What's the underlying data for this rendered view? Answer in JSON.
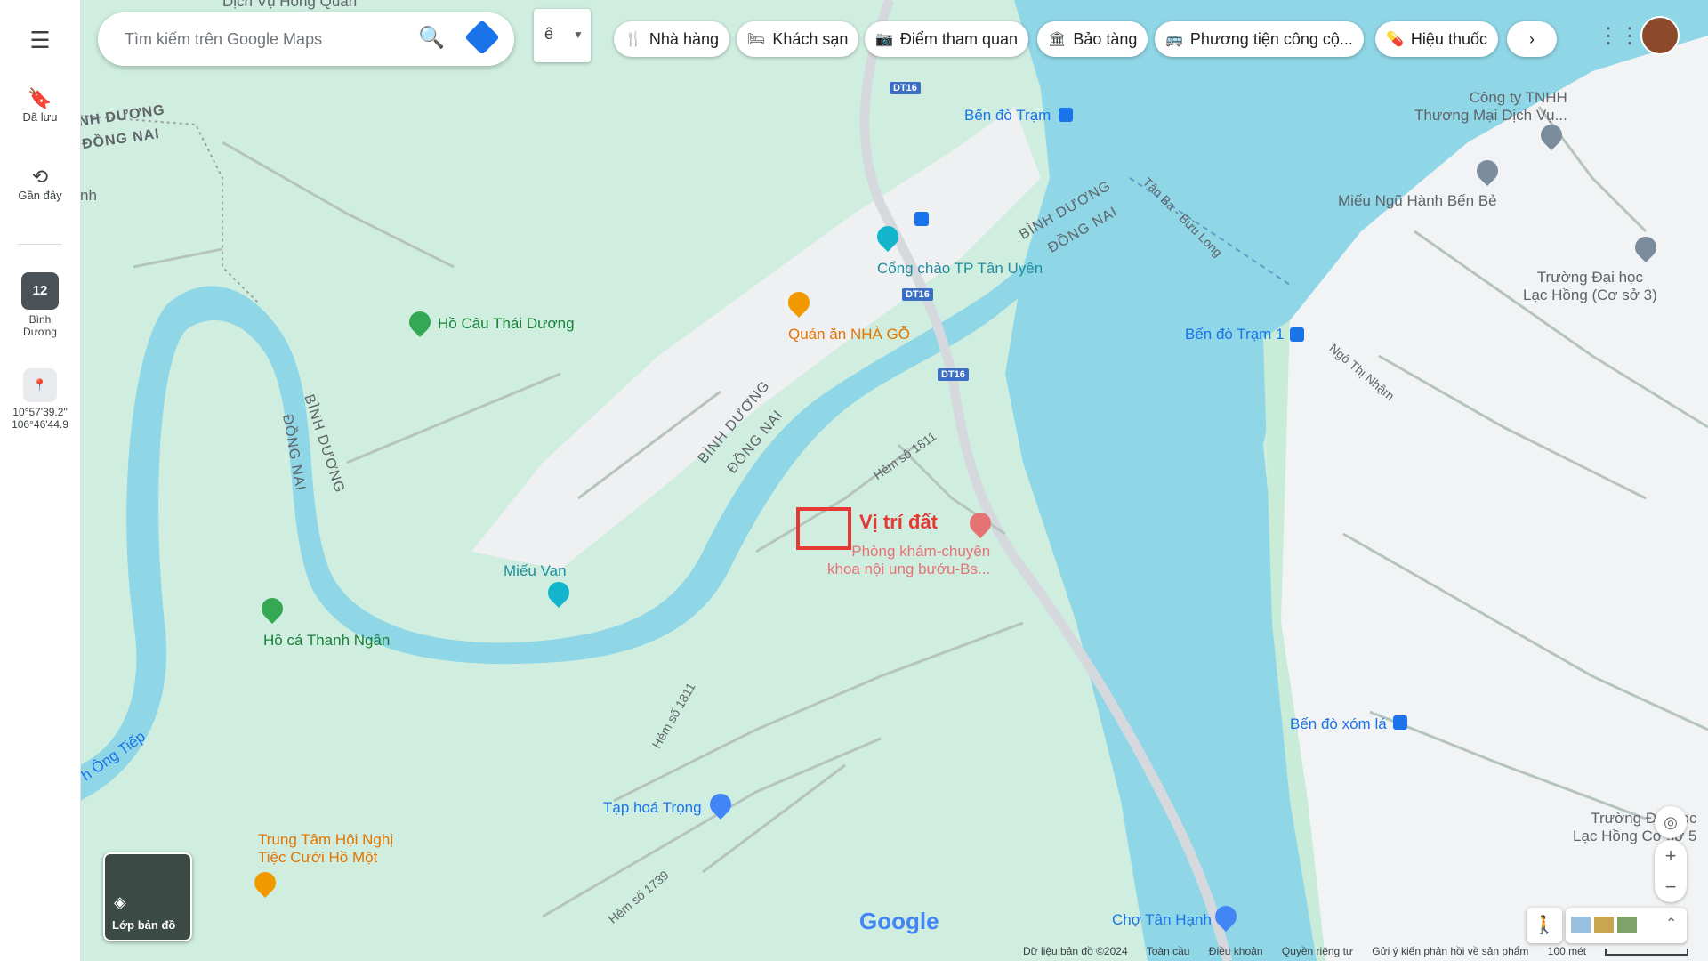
{
  "sidebar": {
    "saved_label": "Đã lưu",
    "recent_label": "Gần đây",
    "place_badge": "12",
    "place_label_line1": "Bình",
    "place_label_line2": "Dương",
    "coords_line1": "10°57'39.2\"",
    "coords_line2": "106°46'44.9"
  },
  "search": {
    "placeholder": "Tìm kiếm trên Google Maps"
  },
  "lang_toggle": "ê",
  "chips": [
    "Nhà hàng",
    "Khách sạn",
    "Điểm tham quan",
    "Bảo tàng",
    "Phương tiện công cộ...",
    "Hiệu thuốc"
  ],
  "map_labels": {
    "top_cut": "Dịch Vụ Hồng Quân",
    "nh_duong": "NH DƯƠNG",
    "dong_nai_top": "ĐỒNG NAI",
    "nh": "nh",
    "ben_do_tram": "Bến đò Trạm",
    "cong_chao": "Cổng chào TP Tân Uyên",
    "binh_duong_river_top": "BÌNH DƯƠNG",
    "dong_nai_river_top": "ĐỒNG NAI",
    "tan_ba_buu_long": "Tân Ba - Bửu Long",
    "cong_ty_line1": "Công ty TNHH",
    "cong_ty_line2": "Thương Mại Dịch Vụ...",
    "mieu_ngu_hanh": "Miếu Ngũ Hành Bến Bẻ",
    "truong_dh_line1": "Trường Đại học",
    "truong_dh_line2": "Lạc Hồng (Cơ sở 3)",
    "ho_cau": "Hồ Câu Thái Dương",
    "quan_an": "Quán ăn NHÀ GỖ",
    "ben_do_tram_1": "Bến đò Trạm 1",
    "ngo_thi_nham": "Ngô Thị Nhậm",
    "binh_duong_mid": "BÌNH DƯƠNG",
    "dong_nai_mid": "ĐỒNG NAI",
    "hem_1811_top": "Hẻm số 1811",
    "dong_nai_left": "ĐỒNG NAI",
    "binh_duong_left": "BÌNH DƯƠNG",
    "vi_tri_dat": "Vị trí đất",
    "phong_kham_line1": "Phòng khám-chuyên",
    "phong_kham_line2": "khoa nội ung bướu-Bs...",
    "mieu_van": "Miếu Van",
    "ho_ca": "Hồ cá Thanh Ngân",
    "hem_1811_bottom": "Hẻm số 1811",
    "ben_do_xom_la": "Bến đò xóm lá",
    "ong_tiep": "h Ông Tiếp",
    "tap_hoa": "Tạp hoá Trọng",
    "trung_tam_line1": "Trung Tâm Hội Nghị",
    "trung_tam_line2": "Tiệc Cưới Hồ Một",
    "hem_1739": "Hẻm số 1739",
    "truong_lh_bottom_line1": "Trường Đại học",
    "truong_lh_bottom_line2": "Lạc Hồng Cơ sở 5",
    "cho_tan_hanh": "Chợ Tân Hạnh",
    "google": "Google"
  },
  "shields": [
    "DT16",
    "DT16",
    "DT16"
  ],
  "layer_label": "Lớp bản đồ",
  "footer": [
    "Dữ liệu bản đồ ©2024",
    "Toàn cầu",
    "Điều khoản",
    "Quyền riêng tư",
    "Gửi ý kiến phản hồi về sản phẩm",
    "100 mét"
  ],
  "colors": {
    "water": "#8fd6e6",
    "land": "#cfeee0",
    "urban": "#f1f3f4",
    "road": "#d5d9de",
    "marker_red": "#e53935"
  }
}
